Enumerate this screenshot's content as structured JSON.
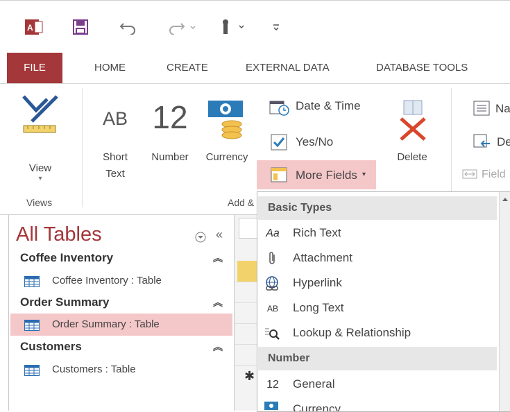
{
  "colors": {
    "accent": "#a4373a",
    "selected_row": "#f4c7c9",
    "highlight_button": "#f4c7c9"
  },
  "qat": {
    "icons": [
      "access-logo-icon",
      "save-icon",
      "undo-icon",
      "redo-icon",
      "touch-mode-icon",
      "customize-qat-icon"
    ],
    "app_logo": "A"
  },
  "tabs": [
    "FILE",
    "HOME",
    "CREATE",
    "EXTERNAL DATA",
    "DATABASE TOOLS"
  ],
  "ribbon": {
    "view": {
      "label": "View"
    },
    "short_text": {
      "glyph": "AB",
      "label_line1": "Short",
      "label_line2": "Text"
    },
    "number": {
      "glyph": "12",
      "label": "Number"
    },
    "currency": {
      "label": "Currency"
    },
    "date_time": "Date & Time",
    "yes_no": "Yes/No",
    "more_fields": "More Fields",
    "delete": "Delete",
    "name_partial": "Na",
    "default_partial": "De",
    "field_partial": "Field",
    "group_views": "Views",
    "group_add": "Add &"
  },
  "nav": {
    "title": "All Tables",
    "groups": [
      {
        "name": "Coffee Inventory",
        "item": "Coffee Inventory : Table"
      },
      {
        "name": "Order Summary",
        "item": "Order Summary : Table"
      },
      {
        "name": "Customers",
        "item": "Customers : Table"
      }
    ]
  },
  "dropdown": {
    "sections": [
      {
        "header": "Basic Types",
        "items": [
          {
            "icon": "Aa",
            "label": "Rich Text"
          },
          {
            "icon": "paperclip",
            "label": "Attachment"
          },
          {
            "icon": "globe-link",
            "label": "Hyperlink"
          },
          {
            "icon": "AB",
            "label": "Long Text"
          },
          {
            "icon": "lookup",
            "label": "Lookup & Relationship"
          }
        ]
      },
      {
        "header": "Number",
        "items": [
          {
            "icon": "12",
            "label": "General"
          },
          {
            "icon": "currency",
            "label": "Currency"
          }
        ]
      }
    ]
  },
  "table": {
    "new_row_marker": "✱"
  }
}
